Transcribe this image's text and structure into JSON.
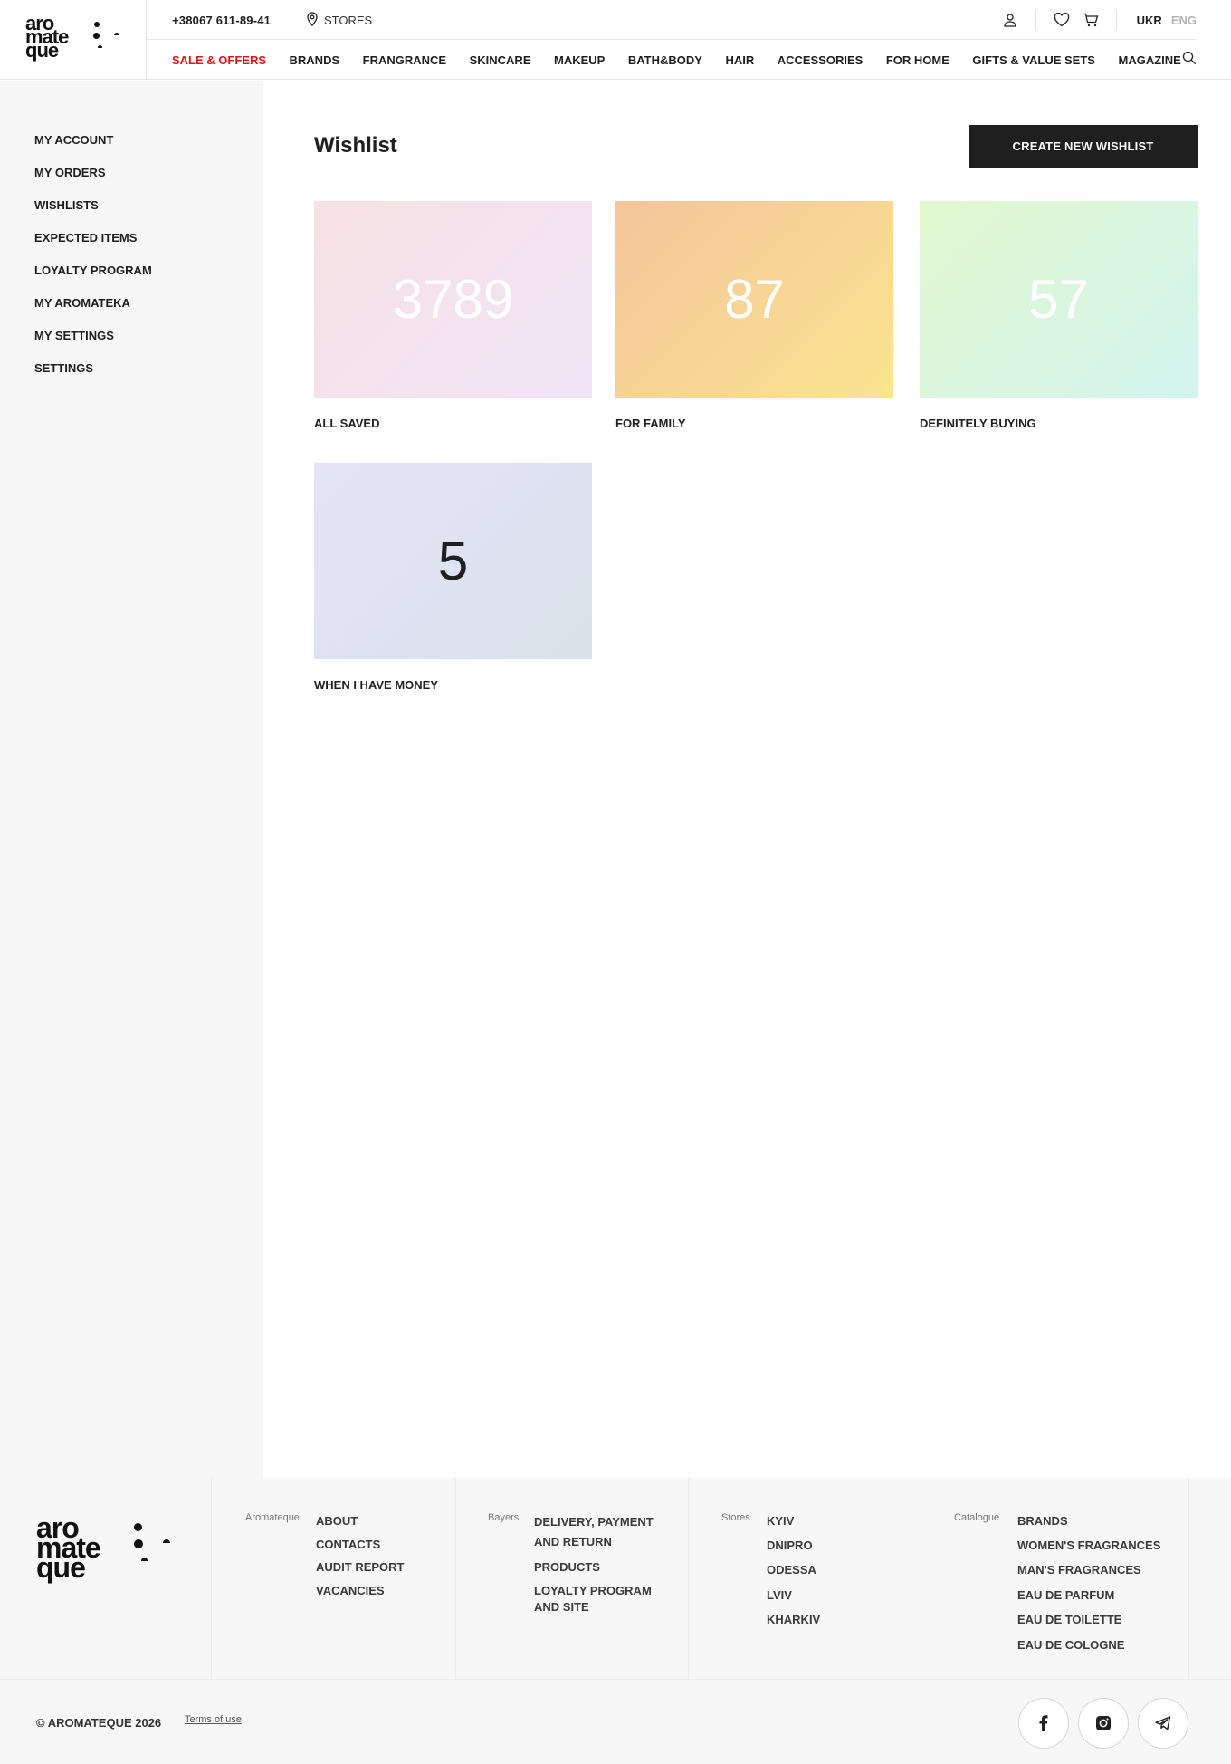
{
  "brand": {
    "name": "aromateque"
  },
  "header": {
    "phone": "+38067 611-89-41",
    "stores_label": "STORES",
    "lang_active": "UKR",
    "lang_inactive": "ENG",
    "nav": [
      "SALE & OFFERS",
      "BRANDS",
      "FRANGRANCE",
      "SKINCARE",
      "MAKEUP",
      "BATH&BODY",
      "HAIR",
      "ACCESSORIES",
      "FOR HOME",
      "GIFTS & VALUE SETS",
      "MAGAZINE"
    ],
    "sale_color": "#e3141b"
  },
  "sidebar": {
    "items": [
      "MY ACCOUNT",
      "MY ORDERS",
      "WISHLISTS",
      "EXPECTED ITEMS",
      "LOYALTY PROGRAM",
      "MY AROMATEKA",
      "MY SETTINGS",
      "SETTINGS"
    ]
  },
  "main": {
    "title": "Wishlist",
    "create_button": "CREATE NEW WISHLIST",
    "wishlists": [
      {
        "count": "3789",
        "label": "ALL SAVED",
        "gradient": [
          "#f6e1e3",
          "#f1e4f7"
        ],
        "text_color": "#ffffff"
      },
      {
        "count": "87",
        "label": "FOR FAMILY",
        "gradient": [
          "#f4c59c",
          "#fbe48f"
        ],
        "text_color": "#ffffff"
      },
      {
        "count": "57",
        "label": "DEFINITELY BUYING",
        "gradient": [
          "#e2f8cf",
          "#d3f4ef"
        ],
        "text_color": "#ffffff"
      },
      {
        "count": "5",
        "label": "WHEN I HAVE MONEY",
        "gradient": [
          "#e6e3f7",
          "#d8e2ea"
        ],
        "text_color": "#1f1f1f"
      }
    ]
  },
  "footer": {
    "columns": [
      {
        "category": "Aromateque",
        "links": [
          "ABOUT",
          "CONTACTS",
          "AUDIT REPORT",
          "VACANCIES"
        ]
      },
      {
        "category": "Bayers",
        "links": [
          "DELIVERY, PAYMENT AND RETURN",
          "PRODUCTS",
          "LOYALTY PROGRAM AND SITE"
        ]
      },
      {
        "category": "Stores",
        "links": [
          "KYIV",
          "DNIPRO",
          "ODESSA",
          "LVIV",
          "KHARKIV"
        ]
      },
      {
        "category": "Catalogue",
        "links": [
          "BRANDS",
          "WOMEN'S FRAGRANCES",
          "MAN'S FRAGRANCES",
          "EAU DE PARFUM",
          "EAU DE TOILETTE",
          "EAU DE COLOGNE"
        ]
      }
    ],
    "copyright": "© AROMATEQUE 2026",
    "terms": "Terms of use",
    "social": [
      "facebook-icon",
      "instagram-icon",
      "telegram-icon"
    ]
  }
}
